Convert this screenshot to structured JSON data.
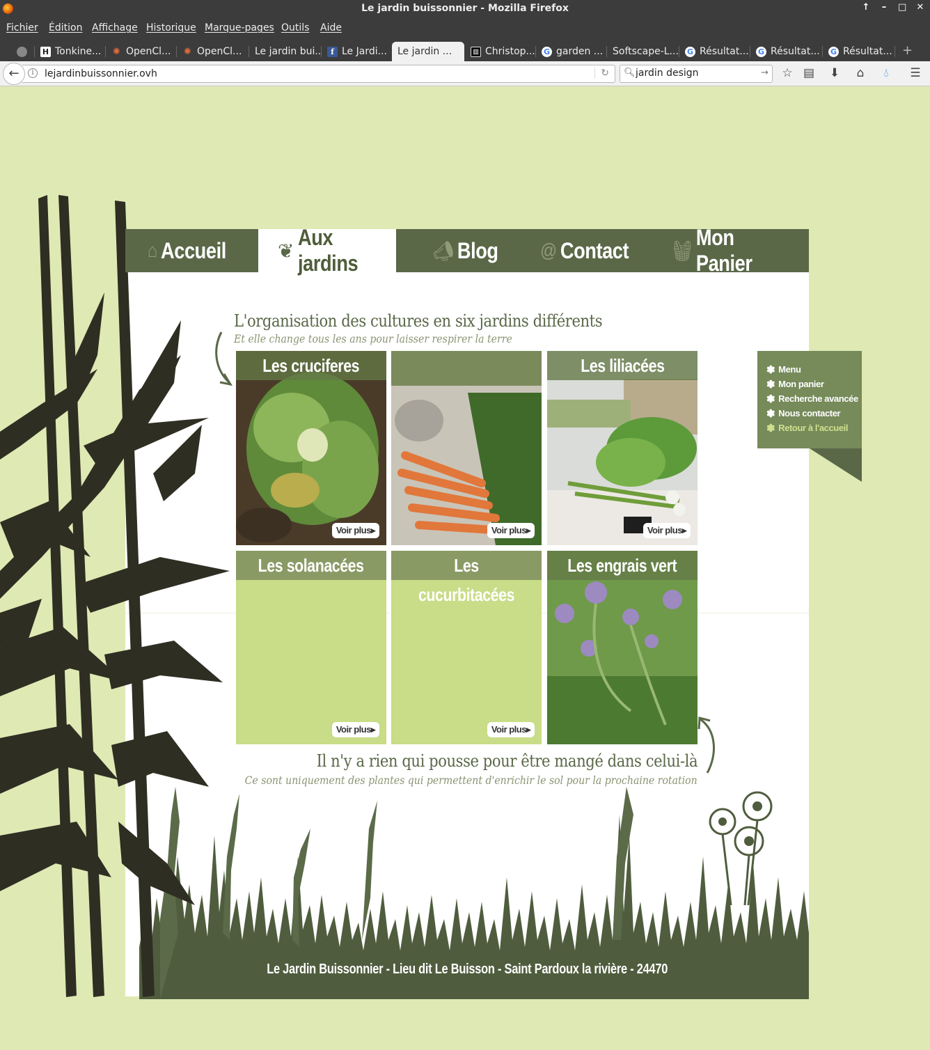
{
  "window": {
    "title": "Le jardin buissonnier - Mozilla Firefox"
  },
  "menubar": [
    "Fichier",
    "Édition",
    "Affichage",
    "Historique",
    "Marque-pages",
    "Outils",
    "Aide"
  ],
  "tabs": [
    {
      "label": "",
      "icon": "globe-icon"
    },
    {
      "label": "Tonkine...",
      "icon": "h-icon"
    },
    {
      "label": "OpenCl...",
      "icon": "openclassrooms-icon"
    },
    {
      "label": "OpenCl...",
      "icon": "openclassrooms-icon"
    },
    {
      "label": "Le jardin bui...",
      "icon": ""
    },
    {
      "label": "Le Jardi...",
      "icon": "facebook-icon"
    },
    {
      "label": "Le jardin ...",
      "icon": "",
      "active": true
    },
    {
      "label": "Christop...",
      "icon": "book-icon"
    },
    {
      "label": "garden ...",
      "icon": "google-icon"
    },
    {
      "label": "Softscape-L...",
      "icon": ""
    },
    {
      "label": "Résultat...",
      "icon": "google-icon"
    },
    {
      "label": "Résultat...",
      "icon": "google-icon"
    },
    {
      "label": "Résultat...",
      "icon": "google-icon"
    }
  ],
  "navbar": {
    "url": "lejardinbuissonnier.ovh",
    "search_value": "jardin design"
  },
  "site": {
    "nav": [
      {
        "label": "Accueil",
        "icon": "barn-icon"
      },
      {
        "label": "Aux jardins",
        "icon": "sprout-icon",
        "active": true
      },
      {
        "label": "Blog",
        "icon": "megaphone-icon"
      },
      {
        "label": "Contact",
        "icon": "at-icon"
      },
      {
        "label": "Mon Panier",
        "icon": "basket-icon"
      }
    ],
    "intro_title": "L'organisation des cultures en six jardins différents",
    "intro_sub": "Et elle change tous les ans pour laisser respirer la terre",
    "cards": [
      {
        "title": "Les cruciferes",
        "voir": "Voir plus▸"
      },
      {
        "title": "",
        "voir": "Voir plus▸"
      },
      {
        "title": "Les liliacées",
        "voir": "Voir plus▸"
      },
      {
        "title": "Les solanacées",
        "voir": "Voir plus▸"
      },
      {
        "title": "Les cucurbitacées",
        "voir": "Voir plus▸"
      },
      {
        "title": "Les engrais vert",
        "voir": ""
      }
    ],
    "outro_title": "Il n'y a rien qui pousse pour être mangé dans celui-là",
    "outro_sub": "Ce sont uniquement des plantes qui permettent d'enrichir le sol pour la prochaine rotation",
    "side_menu": [
      "Menu",
      "Mon panier",
      "Recherche avancée",
      "Nous contacter",
      "Retour à l'accueil"
    ],
    "footer": "Le Jardin Buissonnier - Lieu dit Le Buisson - Saint Pardoux la rivière - 24470"
  },
  "colors": {
    "page_bg": "#dfe9b4",
    "nav_bg": "#5a6848",
    "card_green": "#c9dc87",
    "dark_plant": "#2f2e22",
    "grass": "#4f5d3e"
  }
}
